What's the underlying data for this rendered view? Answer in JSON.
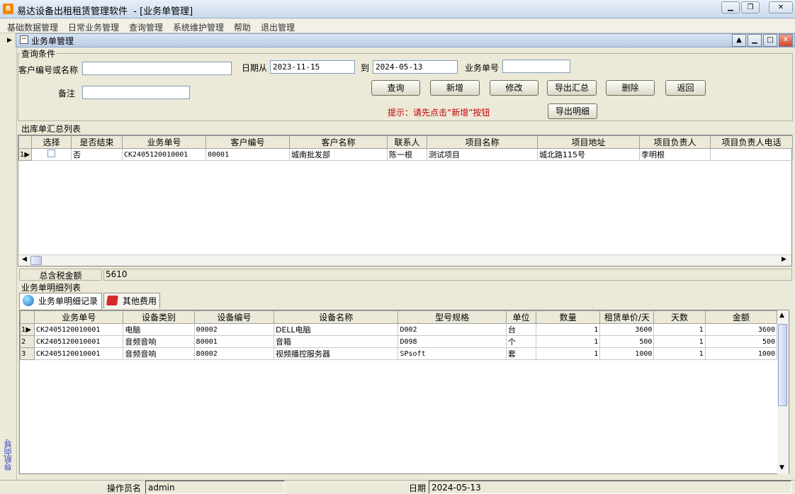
{
  "window": {
    "app_name": "易达设备出租租赁管理软件",
    "subtitle": "- [业务单管理]",
    "icon_label": "8"
  },
  "menu": [
    "基础数据管理",
    "日常业务管理",
    "查询管理",
    "系统维护管理",
    "帮助",
    "退出管理"
  ],
  "child_window": {
    "title": "业务单管理"
  },
  "query": {
    "group_label": "查询条件",
    "customer_label": "客户编号或名称",
    "customer_value": "",
    "date_from_label": "日期从",
    "date_from": "2023-11-15",
    "to_label": "到",
    "date_to": "2024-05-13",
    "order_no_label": "业务单号",
    "order_no_value": "",
    "note_label": "备注",
    "note_value": "",
    "buttons": {
      "query": "查询",
      "add": "新增",
      "edit": "修改",
      "export_summary": "导出汇总",
      "delete": "删除",
      "back": "返回",
      "export_detail": "导出明细"
    },
    "hint": "提示：请先点击“新增”按钮"
  },
  "summary": {
    "group_label": "出库单汇总列表",
    "columns": [
      "选择",
      "是否结束",
      "业务单号",
      "客户编号",
      "客户名称",
      "联系人",
      "项目名称",
      "项目地址",
      "项目负责人",
      "项目负责人电话"
    ],
    "rows": [
      {
        "row_no": "1",
        "selected": false,
        "finished": "否",
        "order_no": "CK2405120010001",
        "customer_no": "00001",
        "customer_name": "城南批发部",
        "contact": "陈一根",
        "project": "测试项目",
        "address": "城北路115号",
        "manager": "李明根",
        "phone": ""
      }
    ],
    "total_label": "总含税金额",
    "total_value": "5610"
  },
  "detail": {
    "group_label": "业务单明细列表",
    "tabs": [
      "业务单明细记录",
      "其他费用"
    ],
    "columns": [
      "业务单号",
      "设备类别",
      "设备编号",
      "设备名称",
      "型号规格",
      "单位",
      "数量",
      "租赁单价/天",
      "天数",
      "金额"
    ],
    "rows": [
      {
        "row_no": "1",
        "order_no": "CK2405120010001",
        "category": "电脑",
        "code": "00002",
        "name": "DELL电脑",
        "model": "D002",
        "unit": "台",
        "qty": "1",
        "price": "3600",
        "days": "1",
        "amount": "3600"
      },
      {
        "row_no": "2",
        "order_no": "CK2405120010001",
        "category": "音频音响",
        "code": "80001",
        "name": "音箱",
        "model": "D098",
        "unit": "个",
        "qty": "1",
        "price": "500",
        "days": "1",
        "amount": "500"
      },
      {
        "row_no": "3",
        "order_no": "CK2405120010001",
        "category": "音频音响",
        "code": "80002",
        "name": "视频播控服务器",
        "model": "SPsoft",
        "unit": "套",
        "qty": "1",
        "price": "1000",
        "days": "1",
        "amount": "1000"
      }
    ]
  },
  "side_nav": "导航向导",
  "status": {
    "operator_label": "操作员名",
    "operator": "admin",
    "date_label": "日期",
    "date": "2024-05-13"
  }
}
